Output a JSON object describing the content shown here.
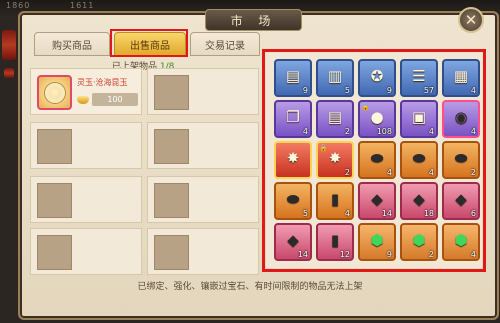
{
  "background": {
    "left_text": "1860",
    "right_text": "1611"
  },
  "window": {
    "title": "市 场"
  },
  "tabs": [
    {
      "label": "购买商品",
      "active": false
    },
    {
      "label": "出售商品",
      "active": true
    },
    {
      "label": "交易记录",
      "active": false
    }
  ],
  "listed": {
    "label": "已上架物品",
    "count": "1/8"
  },
  "listing": {
    "name": "灵玉·沧海昆玉",
    "price": "100"
  },
  "inventory": {
    "rows": [
      [
        {
          "icon": "scroll-icon",
          "quality": "blue",
          "qty": "9"
        },
        {
          "icon": "red-book-icon",
          "quality": "blue",
          "qty": "5"
        },
        {
          "icon": "gold-medal-icon",
          "quality": "blue",
          "qty": "9"
        },
        {
          "icon": "scroll-roll-icon",
          "quality": "blue",
          "qty": "57"
        },
        {
          "icon": "map-icon",
          "quality": "blue",
          "qty": "4"
        }
      ],
      [
        {
          "icon": "open-book-icon",
          "quality": "purple",
          "qty": "4"
        },
        {
          "icon": "scroll-icon",
          "quality": "purple",
          "qty": "2"
        },
        {
          "icon": "coin-icon",
          "quality": "purple",
          "qty": "108",
          "locked": true
        },
        {
          "icon": "treasure-box-icon",
          "quality": "purple",
          "qty": "4"
        },
        {
          "icon": "black-orb-icon",
          "quality": "purple",
          "qty": "4",
          "pink": true
        }
      ],
      [
        {
          "icon": "fire-book-icon",
          "quality": "red",
          "qty": ""
        },
        {
          "icon": "fire-book-icon",
          "quality": "red",
          "qty": "2",
          "locked": true
        },
        {
          "icon": "stone-icon",
          "quality": "orange",
          "qty": "4"
        },
        {
          "icon": "stone-icon",
          "quality": "orange",
          "qty": "4"
        },
        {
          "icon": "stone-icon",
          "quality": "orange",
          "qty": "2"
        }
      ],
      [
        {
          "icon": "stone-icon",
          "quality": "orange",
          "qty": "5"
        },
        {
          "icon": "ore-icon",
          "quality": "orange",
          "qty": "4"
        },
        {
          "icon": "gem-icon",
          "quality": "pink",
          "qty": "14"
        },
        {
          "icon": "gem-icon",
          "quality": "pink",
          "qty": "18"
        },
        {
          "icon": "gem-icon",
          "quality": "pink",
          "qty": "6"
        }
      ],
      [
        {
          "icon": "gem-icon",
          "quality": "pink",
          "qty": "14"
        },
        {
          "icon": "ore-icon",
          "quality": "pink",
          "qty": "12"
        },
        {
          "icon": "green-gem-icon",
          "quality": "green",
          "qty": "9"
        },
        {
          "icon": "green-gem-icon",
          "quality": "green",
          "qty": "2"
        },
        {
          "icon": "green-gem-icon",
          "quality": "green",
          "qty": "4"
        }
      ]
    ]
  },
  "footer": {
    "note": "已绑定、强化、镶嵌过宝石、有时间限制的物品无法上架"
  },
  "colors": {
    "highlight": "#e01818",
    "tab_active": "#f0c04a",
    "price_text": "#d13a2c"
  }
}
